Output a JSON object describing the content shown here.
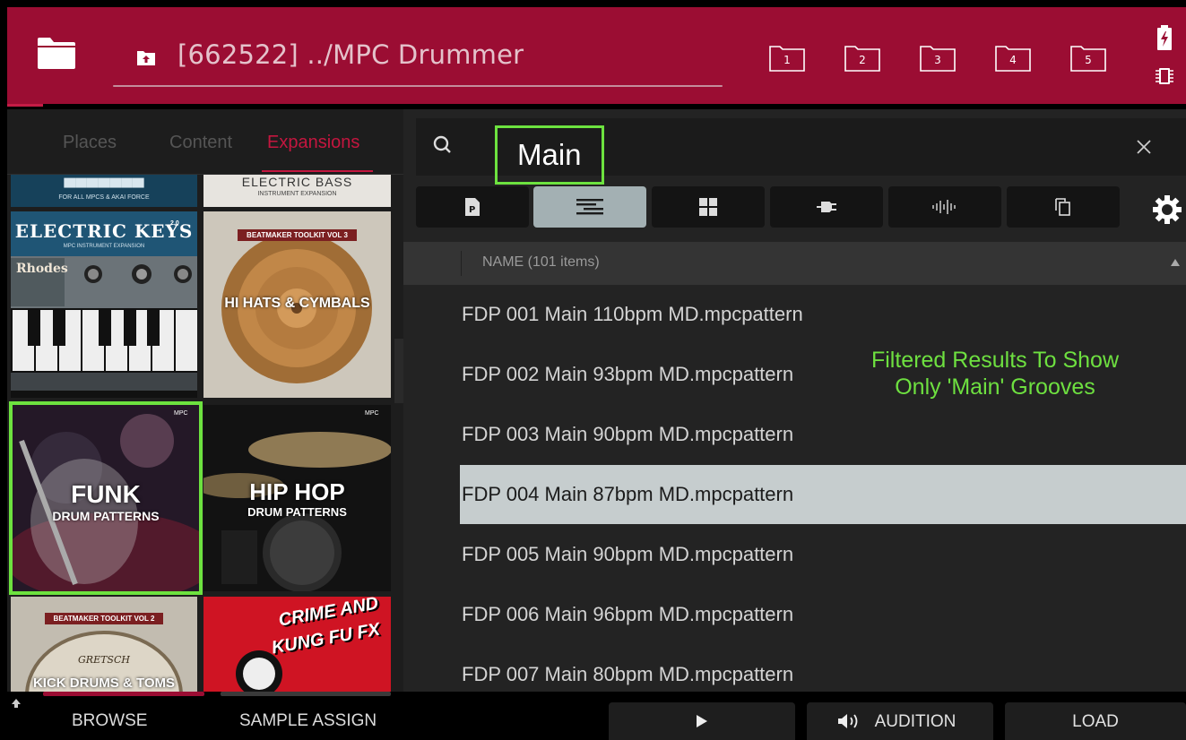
{
  "header": {
    "path": "[662522] ../MPC Drummer",
    "locations": [
      "1",
      "2",
      "3",
      "4",
      "5"
    ]
  },
  "tabs": [
    {
      "label": "Places",
      "active": false
    },
    {
      "label": "Content",
      "active": false
    },
    {
      "label": "Expansions",
      "active": true
    }
  ],
  "expansions": {
    "top_partial_left": "FOR ALL MPCS & AKAI FORCE",
    "top_partial_right": "ELECTRIC BASS",
    "top_partial_right_sub": "INSTRUMENT EXPANSION",
    "electric_keys": {
      "title": "ELECTRIC KEYS",
      "version": "2.0",
      "subtitle": "MPC INSTRUMENT EXPANSION",
      "brand": "Rhodes"
    },
    "hi_hats": {
      "series": "BEATMAKER TOOLKIT VOL 3",
      "title": "HI HATS & CYMBALS"
    },
    "funk": {
      "title": "FUNK",
      "subtitle": "DRUM PATTERNS",
      "small": "MPC"
    },
    "hip_hop": {
      "title": "HIP HOP",
      "subtitle": "DRUM PATTERNS",
      "small": "MPC"
    },
    "kick_drums": {
      "series": "BEATMAKER TOOLKIT VOL 2",
      "title": "KICK DRUMS & TOMS",
      "brand": "GRETSCH"
    },
    "crime": {
      "title_line1": "CRIME AND",
      "title_line2": "KUNG FU FX"
    }
  },
  "search": {
    "value": "Main"
  },
  "filters": [
    {
      "icon": "program-icon",
      "active": false
    },
    {
      "icon": "sequence-icon",
      "active": true
    },
    {
      "icon": "pads-icon",
      "active": false
    },
    {
      "icon": "plugin-icon",
      "active": false
    },
    {
      "icon": "sample-icon",
      "active": false
    },
    {
      "icon": "copy-icon",
      "active": false
    }
  ],
  "list": {
    "header": "NAME (101 items)",
    "items": [
      "FDP 001 Main 110bpm MD.mpcpattern",
      "FDP 002 Main 93bpm MD.mpcpattern",
      "FDP 003 Main 90bpm MD.mpcpattern",
      "FDP 004 Main 87bpm MD.mpcpattern",
      "FDP 005 Main 90bpm MD.mpcpattern",
      "FDP 006 Main 96bpm MD.mpcpattern",
      "FDP 007 Main 80bpm MD.mpcpattern"
    ],
    "selected_index": 3
  },
  "annotation": {
    "line1": "Filtered Results To Show",
    "line2": "Only 'Main' Grooves"
  },
  "bottom": {
    "browse": "BROWSE",
    "sample_assign": "SAMPLE ASSIGN",
    "audition": "AUDITION",
    "load": "LOAD"
  },
  "colors": {
    "header": "#9b0d33",
    "accent": "#c4163f",
    "highlight": "#6de23f",
    "selected_row": "#c6cdce"
  }
}
